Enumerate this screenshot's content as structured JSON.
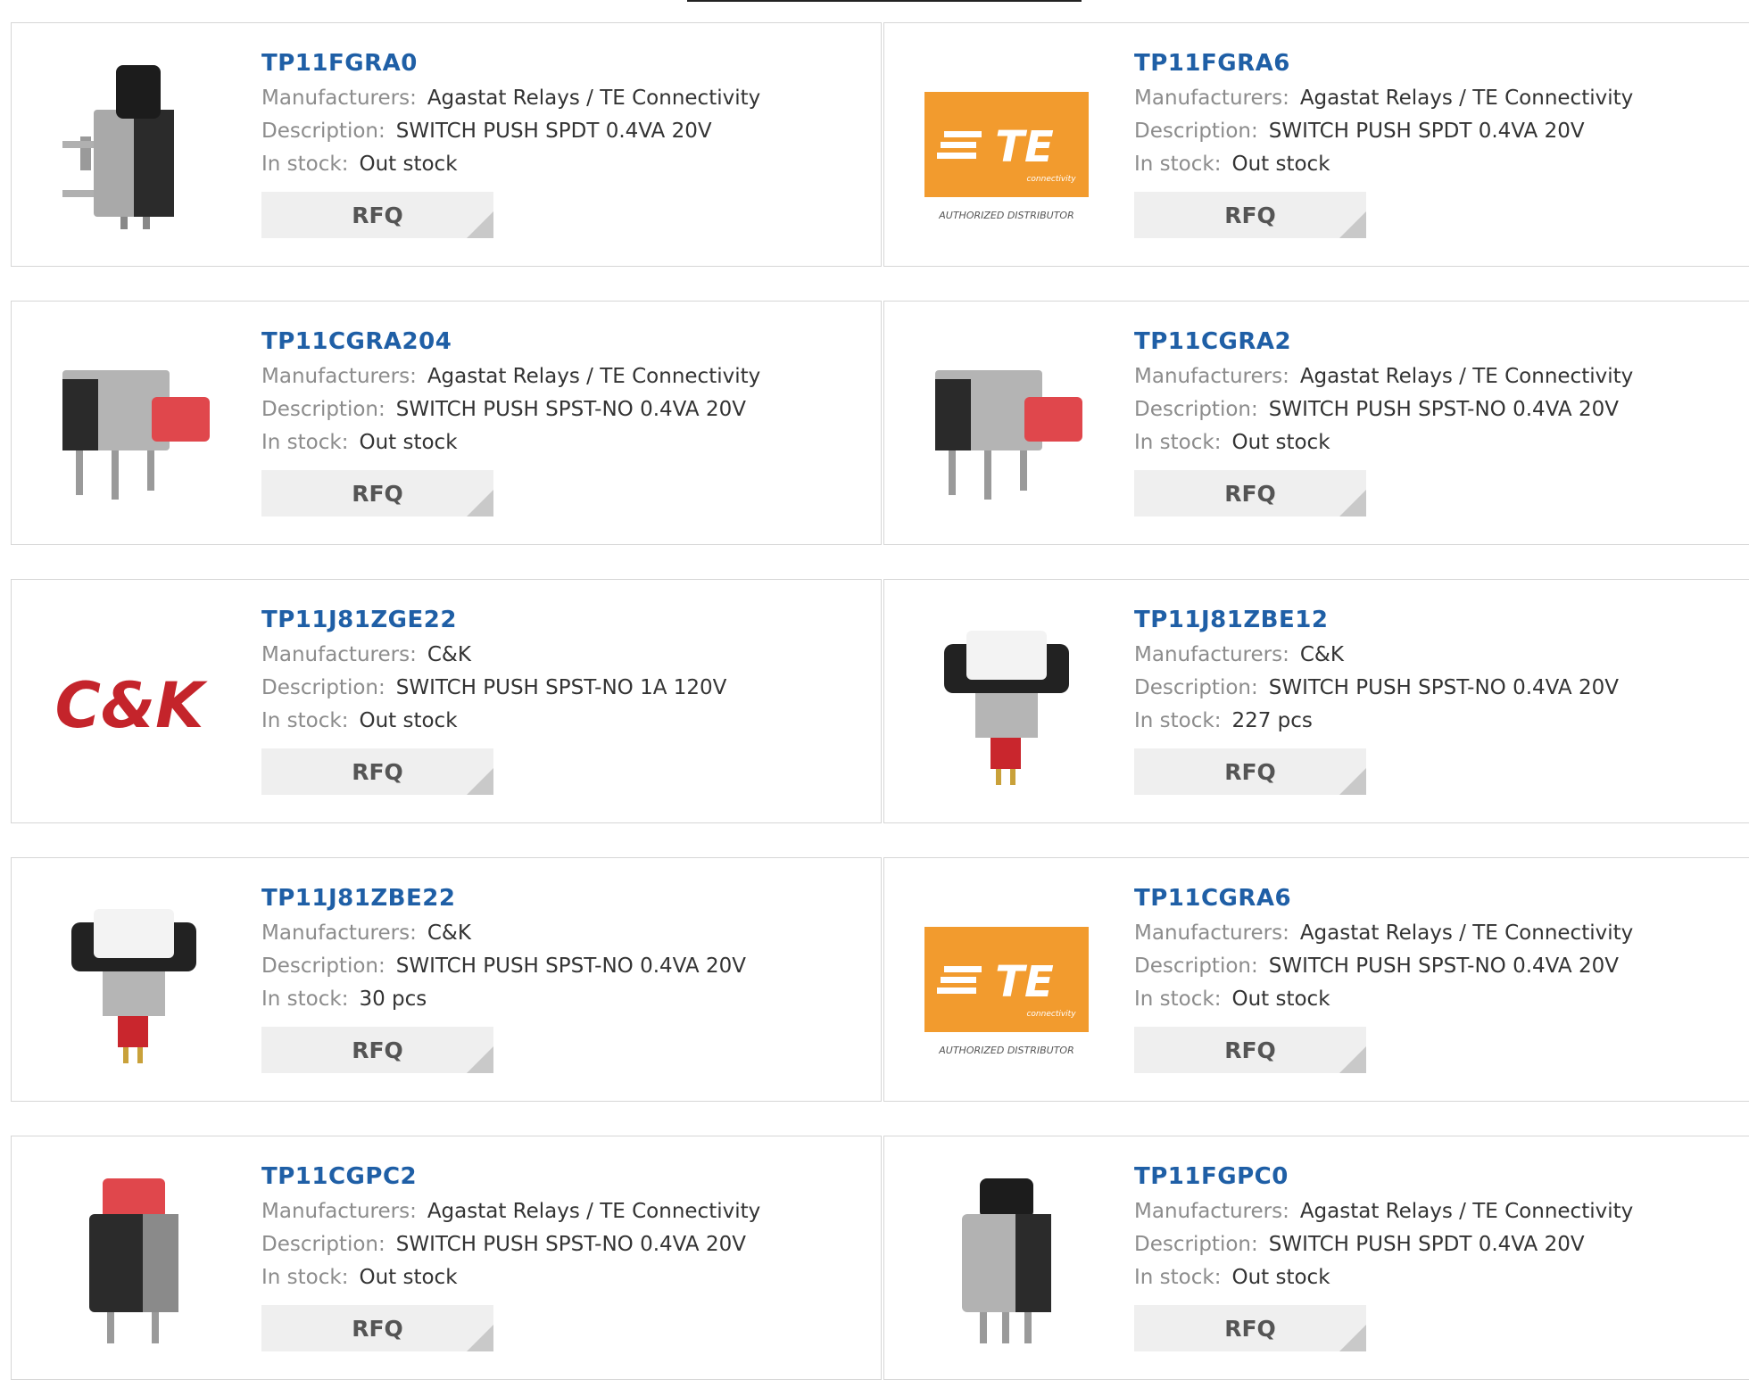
{
  "labels": {
    "manufacturers": "Manufacturers:",
    "description": "Description:",
    "stock": "In stock:",
    "rfq": "RFQ"
  },
  "logos": {
    "te_text": "TE",
    "te_sub": "connectivity",
    "te_caption": "AUTHORIZED DISTRIBUTOR",
    "ck_text": "C&K",
    "te_color": "#f29b2e",
    "ck_color": "#c4242b"
  },
  "colors": {
    "part_link": "#1f5fa6",
    "button_bg": "#efefef"
  },
  "products": [
    {
      "part": "TP11FGRA0",
      "manufacturer": "Agastat Relays / TE Connectivity",
      "description": "SWITCH PUSH SPDT 0.4VA 20V",
      "stock": "Out stock",
      "image": "black-slide-switch-photo"
    },
    {
      "part": "TP11FGRA6",
      "manufacturer": "Agastat Relays / TE Connectivity",
      "description": "SWITCH PUSH SPDT 0.4VA 20V",
      "stock": "Out stock",
      "image": "te-connectivity-logo"
    },
    {
      "part": "TP11CGRA204",
      "manufacturer": "Agastat Relays / TE Connectivity",
      "description": "SWITCH PUSH SPST-NO 0.4VA 20V",
      "stock": "Out stock",
      "image": "red-push-switch-photo"
    },
    {
      "part": "TP11CGRA2",
      "manufacturer": "Agastat Relays / TE Connectivity",
      "description": "SWITCH PUSH SPST-NO 0.4VA 20V",
      "stock": "Out stock",
      "image": "red-push-switch-photo"
    },
    {
      "part": "TP11J81ZGE22",
      "manufacturer": "C&K",
      "description": "SWITCH PUSH SPST-NO 1A 120V",
      "stock": "Out stock",
      "image": "ck-logo"
    },
    {
      "part": "TP11J81ZBE12",
      "manufacturer": "C&K",
      "description": "SWITCH PUSH SPST-NO 0.4VA 20V",
      "stock": "227 pcs",
      "image": "white-push-switch-photo"
    },
    {
      "part": "TP11J81ZBE22",
      "manufacturer": "C&K",
      "description": "SWITCH PUSH SPST-NO 0.4VA 20V",
      "stock": "30 pcs",
      "image": "white-push-switch-photo"
    },
    {
      "part": "TP11CGRA6",
      "manufacturer": "Agastat Relays / TE Connectivity",
      "description": "SWITCH PUSH SPST-NO 0.4VA 20V",
      "stock": "Out stock",
      "image": "te-connectivity-logo"
    },
    {
      "part": "TP11CGPC2",
      "manufacturer": "Agastat Relays / TE Connectivity",
      "description": "SWITCH PUSH SPST-NO 0.4VA 20V",
      "stock": "Out stock",
      "image": "red-vertical-switch-photo"
    },
    {
      "part": "TP11FGPC0",
      "manufacturer": "Agastat Relays / TE Connectivity",
      "description": "SWITCH PUSH SPDT 0.4VA 20V",
      "stock": "Out stock",
      "image": "black-vertical-switch-photo"
    }
  ]
}
